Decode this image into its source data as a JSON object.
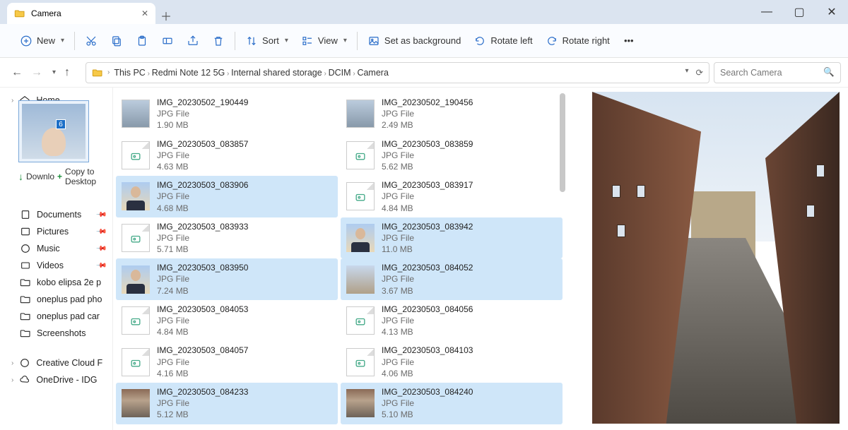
{
  "tab": {
    "title": "Camera"
  },
  "toolbar": {
    "new": "New",
    "sort": "Sort",
    "view": "View",
    "set_bg": "Set as background",
    "rotate_left": "Rotate left",
    "rotate_right": "Rotate right"
  },
  "breadcrumbs": [
    "This PC",
    "Redmi Note 12 5G",
    "Internal shared storage",
    "DCIM",
    "Camera"
  ],
  "search": {
    "placeholder": "Search Camera"
  },
  "sidebar": {
    "home": "Home",
    "downloads": "Downlo",
    "drag_hint": "Copy to Desktop",
    "drag_count": "6",
    "items": [
      {
        "icon": "documents",
        "label": "Documents",
        "pinned": true
      },
      {
        "icon": "pictures",
        "label": "Pictures",
        "pinned": true
      },
      {
        "icon": "music",
        "label": "Music",
        "pinned": true
      },
      {
        "icon": "videos",
        "label": "Videos",
        "pinned": true
      },
      {
        "icon": "folder",
        "label": "kobo elipsa 2e p",
        "pinned": false
      },
      {
        "icon": "folder",
        "label": "oneplus pad pho",
        "pinned": false
      },
      {
        "icon": "folder",
        "label": "oneplus pad car",
        "pinned": false
      },
      {
        "icon": "folder",
        "label": "Screenshots",
        "pinned": false
      }
    ],
    "cloud": [
      {
        "icon": "cc",
        "label": "Creative Cloud F"
      },
      {
        "icon": "onedrive",
        "label": "OneDrive - IDG"
      }
    ]
  },
  "files": [
    {
      "name": "IMG_20230502_190449",
      "type": "JPG File",
      "size": "1.90 MB",
      "sel": false,
      "thumb": "tablet"
    },
    {
      "name": "IMG_20230502_190456",
      "type": "JPG File",
      "size": "2.49 MB",
      "sel": false,
      "thumb": "tablet"
    },
    {
      "name": "IMG_20230503_083857",
      "type": "JPG File",
      "size": "4.63 MB",
      "sel": false,
      "thumb": "jpg"
    },
    {
      "name": "IMG_20230503_083859",
      "type": "JPG File",
      "size": "5.62 MB",
      "sel": false,
      "thumb": "jpg"
    },
    {
      "name": "IMG_20230503_083906",
      "type": "JPG File",
      "size": "4.68 MB",
      "sel": true,
      "thumb": "person"
    },
    {
      "name": "IMG_20230503_083917",
      "type": "JPG File",
      "size": "4.84 MB",
      "sel": false,
      "thumb": "jpg"
    },
    {
      "name": "IMG_20230503_083933",
      "type": "JPG File",
      "size": "5.71 MB",
      "sel": false,
      "thumb": "jpg"
    },
    {
      "name": "IMG_20230503_083942",
      "type": "JPG File",
      "size": "11.0 MB",
      "sel": true,
      "thumb": "person"
    },
    {
      "name": "IMG_20230503_083950",
      "type": "JPG File",
      "size": "7.24 MB",
      "sel": true,
      "thumb": "person"
    },
    {
      "name": "IMG_20230503_084052",
      "type": "JPG File",
      "size": "3.67 MB",
      "sel": true,
      "thumb": "wide"
    },
    {
      "name": "IMG_20230503_084053",
      "type": "JPG File",
      "size": "4.84 MB",
      "sel": false,
      "thumb": "jpg"
    },
    {
      "name": "IMG_20230503_084056",
      "type": "JPG File",
      "size": "4.13 MB",
      "sel": false,
      "thumb": "jpg"
    },
    {
      "name": "IMG_20230503_084057",
      "type": "JPG File",
      "size": "4.16 MB",
      "sel": false,
      "thumb": "jpg"
    },
    {
      "name": "IMG_20230503_084103",
      "type": "JPG File",
      "size": "4.06 MB",
      "sel": false,
      "thumb": "jpg"
    },
    {
      "name": "IMG_20230503_084233",
      "type": "JPG File",
      "size": "5.12 MB",
      "sel": true,
      "thumb": "street"
    },
    {
      "name": "IMG_20230503_084240",
      "type": "JPG File",
      "size": "5.10 MB",
      "sel": true,
      "thumb": "street"
    }
  ]
}
